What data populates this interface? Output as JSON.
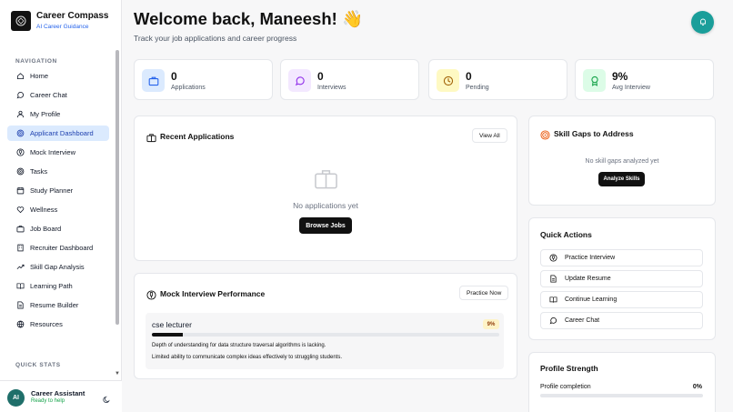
{
  "brand": {
    "title": "Career Compass",
    "subtitle": "AI Career Guidance"
  },
  "nav": {
    "heading": "NAVIGATION",
    "items": [
      {
        "label": "Home",
        "icon": "home-icon",
        "active": false
      },
      {
        "label": "Career Chat",
        "icon": "chat-icon",
        "active": false
      },
      {
        "label": "My Profile",
        "icon": "user-icon",
        "active": false
      },
      {
        "label": "Applicant Dashboard",
        "icon": "target-icon",
        "active": true
      },
      {
        "label": "Mock Interview",
        "icon": "mic-icon",
        "active": false
      },
      {
        "label": "Tasks",
        "icon": "target-icon",
        "active": false
      },
      {
        "label": "Study Planner",
        "icon": "calendar-icon",
        "active": false
      },
      {
        "label": "Wellness",
        "icon": "heart-icon",
        "active": false
      },
      {
        "label": "Job Board",
        "icon": "briefcase-icon",
        "active": false
      },
      {
        "label": "Recruiter Dashboard",
        "icon": "building-icon",
        "active": false
      },
      {
        "label": "Skill Gap Analysis",
        "icon": "trend-icon",
        "active": false
      },
      {
        "label": "Learning Path",
        "icon": "book-icon",
        "active": false
      },
      {
        "label": "Resume Builder",
        "icon": "document-icon",
        "active": false
      },
      {
        "label": "Resources",
        "icon": "globe-icon",
        "active": false
      }
    ]
  },
  "quick_stats_heading": "QUICK STATS",
  "assistant": {
    "initials": "AI",
    "name": "Career Assistant",
    "status": "Ready to help"
  },
  "header": {
    "welcome": "Welcome back, Maneesh! 👋",
    "subtitle": "Track your job applications and career progress"
  },
  "stats": [
    {
      "value": "0",
      "label": "Applications",
      "icon": "briefcase-icon",
      "color": "#dbeafe",
      "iconColor": "#2563eb"
    },
    {
      "value": "0",
      "label": "Interviews",
      "icon": "chat-icon",
      "color": "#f3e8ff",
      "iconColor": "#9333ea"
    },
    {
      "value": "0",
      "label": "Pending",
      "icon": "clock-icon",
      "color": "#fef9c3",
      "iconColor": "#a16207"
    },
    {
      "value": "9%",
      "label": "Avg Interview",
      "icon": "award-icon",
      "color": "#dcfce7",
      "iconColor": "#16a34a"
    }
  ],
  "recent_applications": {
    "title": "Recent Applications",
    "view_all": "View All",
    "empty_text": "No applications yet",
    "browse_button": "Browse Jobs"
  },
  "mock_performance": {
    "title": "Mock Interview Performance",
    "practice_button": "Practice Now",
    "role": "cse lecturer",
    "score": "9%",
    "score_value": 9,
    "feedback": [
      "Depth of understanding for data structure traversal algorithms is lacking.",
      "Limited ability to communicate complex ideas effectively to struggling students."
    ]
  },
  "skill_gaps": {
    "title": "Skill Gaps to Address",
    "empty_text": "No skill gaps analyzed yet",
    "analyze_button": "Analyze Skills"
  },
  "quick_actions": {
    "title": "Quick Actions",
    "items": [
      {
        "label": "Practice Interview",
        "icon": "mic-icon"
      },
      {
        "label": "Update Resume",
        "icon": "document-icon"
      },
      {
        "label": "Continue Learning",
        "icon": "book-icon"
      },
      {
        "label": "Career Chat",
        "icon": "chat-icon"
      }
    ]
  },
  "profile_strength": {
    "title": "Profile Strength",
    "label": "Profile completion",
    "value": "0%",
    "fraction": 0
  }
}
